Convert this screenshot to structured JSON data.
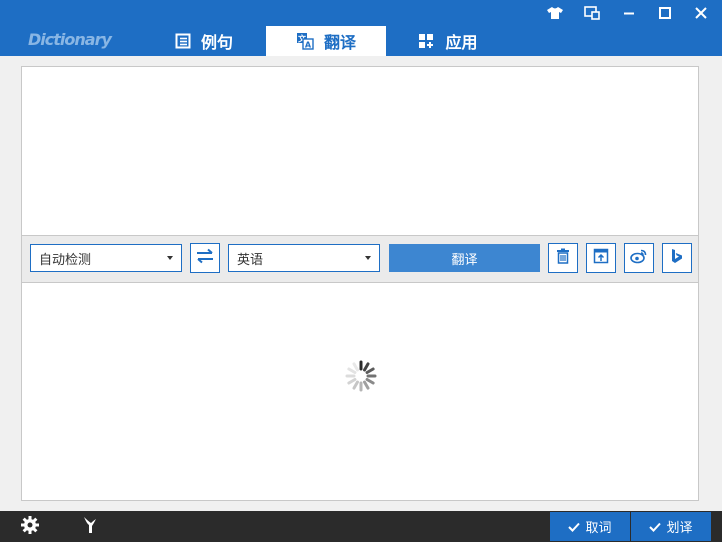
{
  "app": {
    "logo_text": "Dictionary"
  },
  "tabs": [
    {
      "label": "例句",
      "icon": "document-list-icon"
    },
    {
      "label": "翻译",
      "icon": "translate-icon",
      "active": true
    },
    {
      "label": "应用",
      "icon": "apps-icon"
    }
  ],
  "window_controls": [
    "skin-icon",
    "mini-mode-icon",
    "minimize-icon",
    "maximize-icon",
    "close-icon"
  ],
  "input": {
    "value": "",
    "placeholder": ""
  },
  "toolbar": {
    "source_language": "自动检测",
    "target_language": "英语",
    "translate_label": "翻译",
    "tool_icons": [
      "delete-icon",
      "pin-icon",
      "weibo-icon",
      "bing-icon"
    ]
  },
  "output": {
    "value": "",
    "loading": true
  },
  "statusbar": {
    "left_icons": [
      "settings-icon",
      "mic-icon"
    ],
    "cancel_word_label": "取词",
    "select_translate_label": "划译"
  },
  "colors": {
    "accent": "#1e6ec4",
    "button": "#3d86d1",
    "statusbar": "#2b2b2b"
  }
}
